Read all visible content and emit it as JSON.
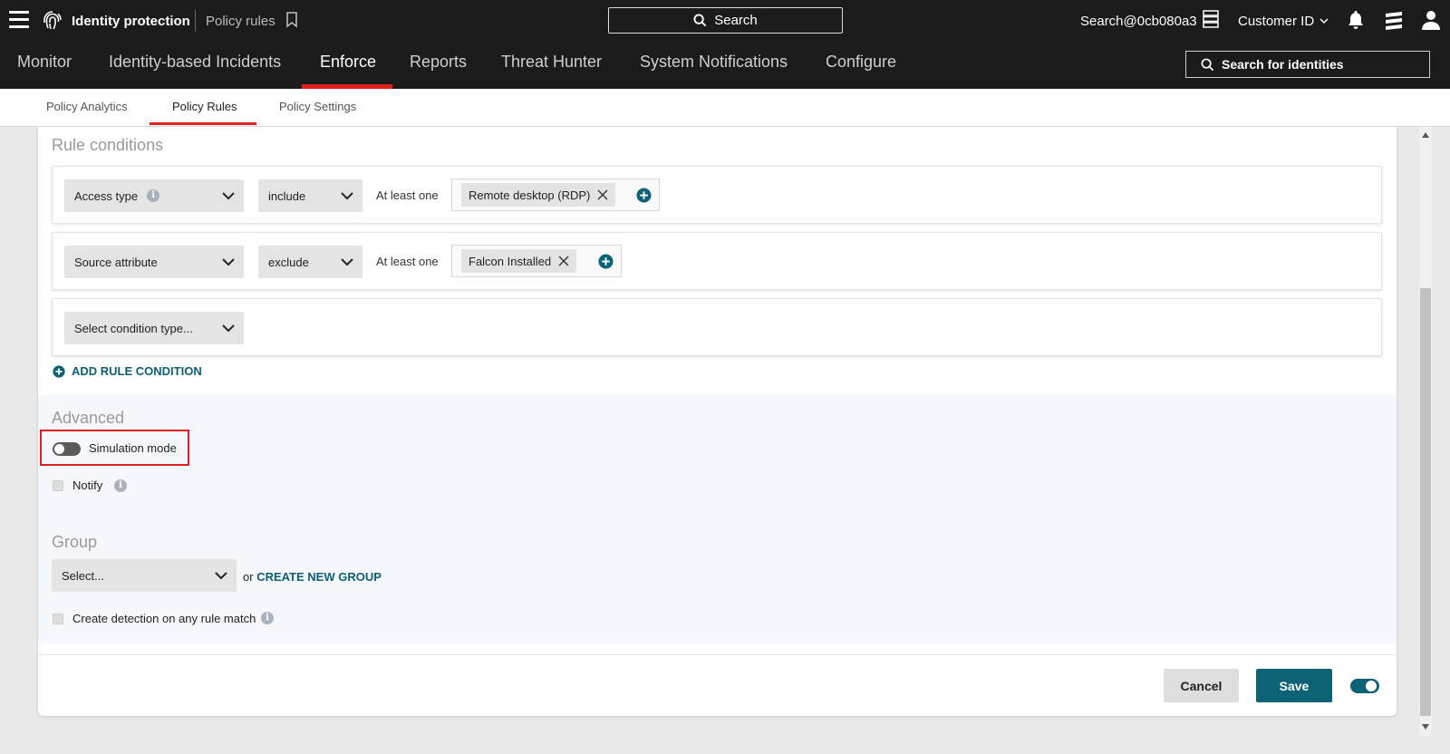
{
  "topbar": {
    "product": "Identity protection",
    "breadcrumb": "Policy rules",
    "search_label": "Search",
    "user": "Search@0cb080a3",
    "customer_label": "Customer ID"
  },
  "main_nav": {
    "tabs": [
      {
        "label": "Monitor"
      },
      {
        "label": "Identity-based Incidents"
      },
      {
        "label": "Enforce",
        "active": true
      },
      {
        "label": "Reports"
      },
      {
        "label": "Threat Hunter"
      },
      {
        "label": "System Notifications"
      },
      {
        "label": "Configure"
      }
    ],
    "identity_search": "Search for identities"
  },
  "sub_nav": {
    "tabs": [
      {
        "label": "Policy Analytics"
      },
      {
        "label": "Policy Rules",
        "active": true
      },
      {
        "label": "Policy Settings"
      }
    ]
  },
  "rule_conditions": {
    "title": "Rule conditions",
    "conditions": [
      {
        "type": "Access type",
        "operator": "include",
        "quantifier": "At least one",
        "values": [
          "Remote desktop (RDP)"
        ]
      },
      {
        "type": "Source attribute",
        "operator": "exclude",
        "quantifier": "At least one",
        "values": [
          "Falcon Installed"
        ]
      },
      {
        "type": "Select condition type..."
      }
    ],
    "add_label": "ADD RULE CONDITION"
  },
  "advanced": {
    "title": "Advanced",
    "simulation_label": "Simulation mode",
    "simulation_on": false,
    "notify_label": "Notify"
  },
  "group": {
    "title": "Group",
    "select_placeholder": "Select...",
    "or_text": "or",
    "create_link": "CREATE NEW GROUP",
    "detection_label": "Create detection on any rule match"
  },
  "footer": {
    "cancel_label": "Cancel",
    "save_label": "Save",
    "enabled": true
  },
  "colors": {
    "accent_red": "#e0211f",
    "teal": "#0d6275",
    "topbar_bg": "#1b1b1b"
  }
}
